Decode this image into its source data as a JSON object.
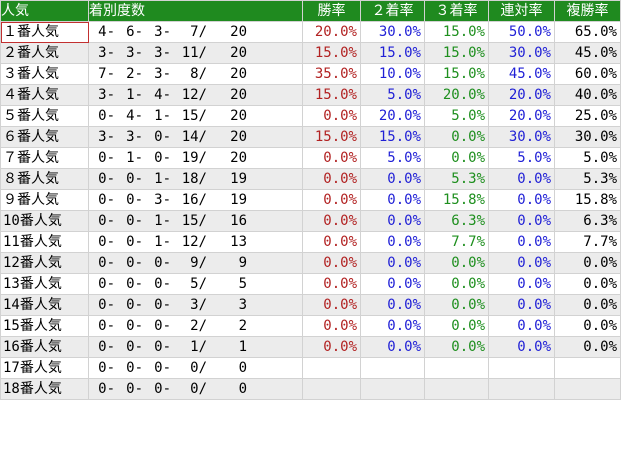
{
  "headers": {
    "popularity": "人気",
    "record": "着別度数",
    "win_rate": "勝率",
    "second_rate": "２着率",
    "third_rate": "３着率",
    "quinella_rate": "連対率",
    "place_rate": "複勝率"
  },
  "colors": {
    "header_bg": "#1f8a1f",
    "win_rate": "#b22222",
    "second_rate": "#1f1fd6",
    "third_rate": "#1e8f1e",
    "quinella_rate": "#1f1fd6",
    "place_rate": "#000000",
    "alt_row": "#ececec",
    "selected_border": "#c23030"
  },
  "rows": [
    {
      "label": "１番人気",
      "first": "4-",
      "second": "6-",
      "third": "3-",
      "other": "7/",
      "total": "20",
      "win": "20.0%",
      "sec": "30.0%",
      "thr": "15.0%",
      "quin": "50.0%",
      "place": "65.0%"
    },
    {
      "label": "２番人気",
      "first": "3-",
      "second": "3-",
      "third": "3-",
      "other": "11/",
      "total": "20",
      "win": "15.0%",
      "sec": "15.0%",
      "thr": "15.0%",
      "quin": "30.0%",
      "place": "45.0%"
    },
    {
      "label": "３番人気",
      "first": "7-",
      "second": "2-",
      "third": "3-",
      "other": "8/",
      "total": "20",
      "win": "35.0%",
      "sec": "10.0%",
      "thr": "15.0%",
      "quin": "45.0%",
      "place": "60.0%"
    },
    {
      "label": "４番人気",
      "first": "3-",
      "second": "1-",
      "third": "4-",
      "other": "12/",
      "total": "20",
      "win": "15.0%",
      "sec": "5.0%",
      "thr": "20.0%",
      "quin": "20.0%",
      "place": "40.0%"
    },
    {
      "label": "５番人気",
      "first": "0-",
      "second": "4-",
      "third": "1-",
      "other": "15/",
      "total": "20",
      "win": "0.0%",
      "sec": "20.0%",
      "thr": "5.0%",
      "quin": "20.0%",
      "place": "25.0%"
    },
    {
      "label": "６番人気",
      "first": "3-",
      "second": "3-",
      "third": "0-",
      "other": "14/",
      "total": "20",
      "win": "15.0%",
      "sec": "15.0%",
      "thr": "0.0%",
      "quin": "30.0%",
      "place": "30.0%"
    },
    {
      "label": "７番人気",
      "first": "0-",
      "second": "1-",
      "third": "0-",
      "other": "19/",
      "total": "20",
      "win": "0.0%",
      "sec": "5.0%",
      "thr": "0.0%",
      "quin": "5.0%",
      "place": "5.0%"
    },
    {
      "label": "８番人気",
      "first": "0-",
      "second": "0-",
      "third": "1-",
      "other": "18/",
      "total": "19",
      "win": "0.0%",
      "sec": "0.0%",
      "thr": "5.3%",
      "quin": "0.0%",
      "place": "5.3%"
    },
    {
      "label": "９番人気",
      "first": "0-",
      "second": "0-",
      "third": "3-",
      "other": "16/",
      "total": "19",
      "win": "0.0%",
      "sec": "0.0%",
      "thr": "15.8%",
      "quin": "0.0%",
      "place": "15.8%"
    },
    {
      "label": "10番人気",
      "first": "0-",
      "second": "0-",
      "third": "1-",
      "other": "15/",
      "total": "16",
      "win": "0.0%",
      "sec": "0.0%",
      "thr": "6.3%",
      "quin": "0.0%",
      "place": "6.3%"
    },
    {
      "label": "11番人気",
      "first": "0-",
      "second": "0-",
      "third": "1-",
      "other": "12/",
      "total": "13",
      "win": "0.0%",
      "sec": "0.0%",
      "thr": "7.7%",
      "quin": "0.0%",
      "place": "7.7%"
    },
    {
      "label": "12番人気",
      "first": "0-",
      "second": "0-",
      "third": "0-",
      "other": "9/",
      "total": "9",
      "win": "0.0%",
      "sec": "0.0%",
      "thr": "0.0%",
      "quin": "0.0%",
      "place": "0.0%"
    },
    {
      "label": "13番人気",
      "first": "0-",
      "second": "0-",
      "third": "0-",
      "other": "5/",
      "total": "5",
      "win": "0.0%",
      "sec": "0.0%",
      "thr": "0.0%",
      "quin": "0.0%",
      "place": "0.0%"
    },
    {
      "label": "14番人気",
      "first": "0-",
      "second": "0-",
      "third": "0-",
      "other": "3/",
      "total": "3",
      "win": "0.0%",
      "sec": "0.0%",
      "thr": "0.0%",
      "quin": "0.0%",
      "place": "0.0%"
    },
    {
      "label": "15番人気",
      "first": "0-",
      "second": "0-",
      "third": "0-",
      "other": "2/",
      "total": "2",
      "win": "0.0%",
      "sec": "0.0%",
      "thr": "0.0%",
      "quin": "0.0%",
      "place": "0.0%"
    },
    {
      "label": "16番人気",
      "first": "0-",
      "second": "0-",
      "third": "0-",
      "other": "1/",
      "total": "1",
      "win": "0.0%",
      "sec": "0.0%",
      "thr": "0.0%",
      "quin": "0.0%",
      "place": "0.0%"
    },
    {
      "label": "17番人気",
      "first": "0-",
      "second": "0-",
      "third": "0-",
      "other": "0/",
      "total": "0",
      "win": "",
      "sec": "",
      "thr": "",
      "quin": "",
      "place": ""
    },
    {
      "label": "18番人気",
      "first": "0-",
      "second": "0-",
      "third": "0-",
      "other": "0/",
      "total": "0",
      "win": "",
      "sec": "",
      "thr": "",
      "quin": "",
      "place": ""
    }
  ]
}
